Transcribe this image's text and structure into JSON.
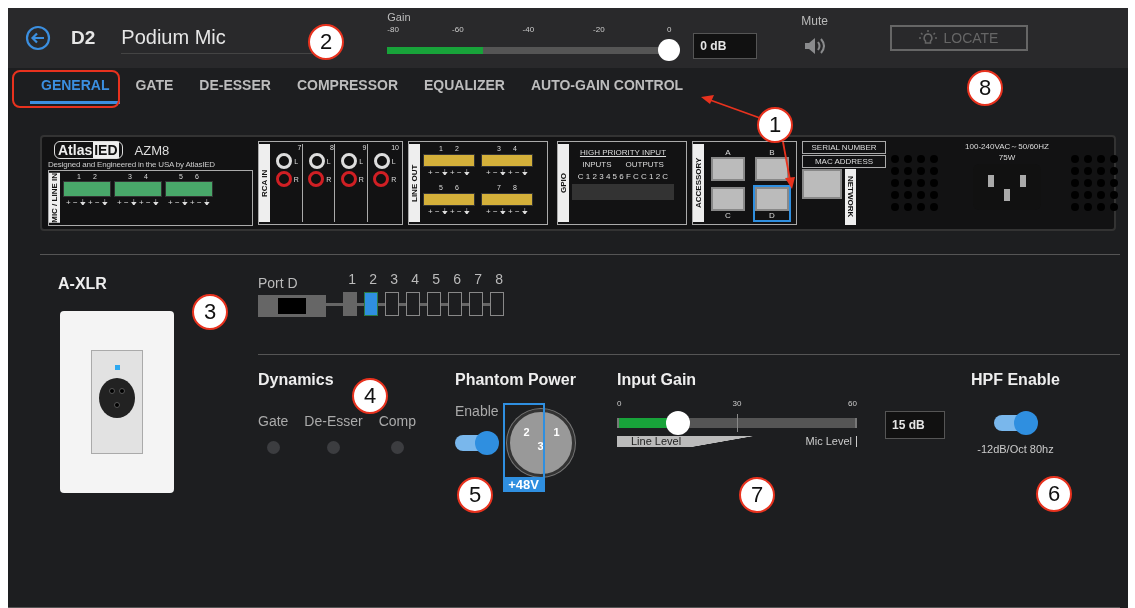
{
  "header": {
    "channel": "D2",
    "name": "Podium Mic",
    "gain": {
      "label": "Gain",
      "ticks": [
        "-80",
        "-60",
        "-40",
        "-20",
        "0"
      ],
      "meter": {
        "level": 0.34
      },
      "slider": {
        "level": 1
      },
      "value": "0 dB"
    },
    "mute": {
      "label": "Mute",
      "on": false
    },
    "locate": {
      "label": "LOCATE",
      "disabled": true
    }
  },
  "tabs": [
    {
      "label": "GENERAL",
      "selected": true
    },
    {
      "label": "GATE",
      "selected": false
    },
    {
      "label": "DE-ESSER",
      "selected": false
    },
    {
      "label": "COMPRESSOR",
      "selected": false
    },
    {
      "label": "EQUALIZER",
      "selected": false
    },
    {
      "label": "AUTO-GAIN CONTROL",
      "selected": false
    }
  ],
  "device_panel": {
    "logo_word": "Atlas",
    "logo_mark": "IED",
    "model": "AZM8",
    "tagline": "Designed and Engineered in the USA by AtlasIED",
    "mic_in": {
      "label": "MIC / LINE IN",
      "blocks": [
        {
          "channels": [
            "1",
            "2"
          ],
          "legend": "+ − ⏚ + − ⏚"
        },
        {
          "channels": [
            "3",
            "4"
          ],
          "legend": "+ − ⏚ + − ⏚"
        },
        {
          "channels": [
            "5",
            "6"
          ],
          "legend": "+ − ⏚ + − ⏚"
        }
      ]
    },
    "rca_in": {
      "label": "RCA IN",
      "channels": [
        {
          "number": "7",
          "left": "L",
          "right": "R"
        },
        {
          "number": "8",
          "left": "L",
          "right": "R"
        },
        {
          "number": "9",
          "left": "L",
          "right": "R"
        },
        {
          "number": "10",
          "left": "L",
          "right": "R"
        }
      ]
    },
    "line_out": {
      "label": "LINE OUT",
      "blocks": [
        {
          "channels": [
            "1",
            "2"
          ],
          "legend": "+ − ⏚ + − ⏚"
        },
        {
          "channels": [
            "3",
            "4"
          ],
          "legend": "+ − ⏚ + − ⏚"
        },
        {
          "channels": [
            "5",
            "6"
          ],
          "legend": "+ − ⏚ + − ⏚"
        },
        {
          "channels": [
            "7",
            "8"
          ],
          "legend": "+ − ⏚ + − ⏚"
        }
      ]
    },
    "gpio": {
      "label": "GPIO",
      "title": "HIGH PRIORITY INPUT",
      "inputs": "INPUTS",
      "outputs": "OUTPUTS",
      "pins": "C 1 2 3 4 5 6 F C C 1 2 C"
    },
    "accessory": {
      "label": "ACCESSORY",
      "ports": [
        {
          "label": "A",
          "selected": false
        },
        {
          "label": "B",
          "selected": false
        },
        {
          "label": "C",
          "selected": false
        },
        {
          "label": "D",
          "selected": true
        }
      ]
    },
    "network": {
      "serial": "SERIAL NUMBER",
      "mac": "MAC ADDRESS",
      "label": "NETWORK"
    },
    "power": {
      "rating": "100-240VAC～50/60HZ",
      "watts": "75W"
    }
  },
  "input": {
    "name": "A-XLR",
    "port_label": "Port D",
    "slots": [
      {
        "label": "1",
        "occupied": true,
        "selected": false
      },
      {
        "label": "2",
        "occupied": true,
        "selected": true
      },
      {
        "label": "3",
        "occupied": false,
        "selected": false
      },
      {
        "label": "4",
        "occupied": false,
        "selected": false
      },
      {
        "label": "5",
        "occupied": false,
        "selected": false
      },
      {
        "label": "6",
        "occupied": false,
        "selected": false
      },
      {
        "label": "7",
        "occupied": false,
        "selected": false
      },
      {
        "label": "8",
        "occupied": false,
        "selected": false
      }
    ]
  },
  "dynamics": {
    "title": "Dynamics",
    "indicators": [
      {
        "label": "Gate",
        "on": false
      },
      {
        "label": "De-Esser",
        "on": false
      },
      {
        "label": "Comp",
        "on": false
      }
    ]
  },
  "phantom": {
    "title": "Phantom Power",
    "enable_label": "Enable",
    "on": true,
    "pins": [
      "2",
      "1",
      "3"
    ],
    "voltage": "+48V"
  },
  "input_gain": {
    "title": "Input Gain",
    "ticks": [
      "0",
      "30",
      "60"
    ],
    "level": 0.25,
    "value": "15 dB",
    "low_label": "Line Level",
    "high_label": "Mic Level"
  },
  "hpf": {
    "title": "HPF Enable",
    "on": true,
    "caption": "-12dB/Oct 80hz"
  },
  "annotations": [
    {
      "number": "2"
    },
    {
      "number": "8"
    },
    {
      "number": "1"
    },
    {
      "number": "3"
    },
    {
      "number": "4"
    },
    {
      "number": "5"
    },
    {
      "number": "7"
    },
    {
      "number": "6"
    }
  ]
}
